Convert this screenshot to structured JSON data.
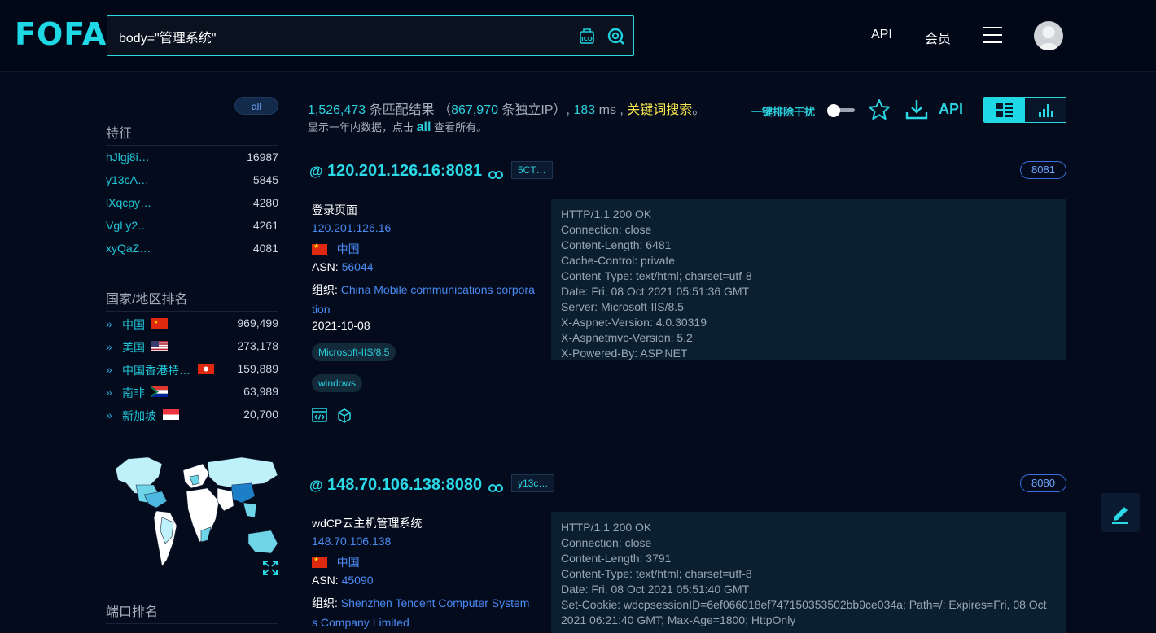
{
  "app": {
    "logo": "FOFA"
  },
  "search": {
    "query": "body=\"管理系统\""
  },
  "nav": {
    "api": "API",
    "member": "会员"
  },
  "sidebar": {
    "all_pill": "all",
    "features_title": "特征",
    "features": [
      {
        "label": "hJlgj8i…",
        "count": "16987"
      },
      {
        "label": "y13cA…",
        "count": "5845"
      },
      {
        "label": "lXqcpy…",
        "count": "4280"
      },
      {
        "label": "VgLy2…",
        "count": "4261"
      },
      {
        "label": "xyQaZ…",
        "count": "4081"
      }
    ],
    "country_title": "国家/地区排名",
    "countries": [
      {
        "name": "中国",
        "count": "969,499"
      },
      {
        "name": "美国",
        "count": "273,178"
      },
      {
        "name": "中国香港特…",
        "count": "159,889"
      },
      {
        "name": "南非",
        "count": "63,989"
      },
      {
        "name": "新加坡",
        "count": "20,700"
      }
    ],
    "port_title": "端口排名"
  },
  "summary": {
    "total": "1,526,473",
    "total_suffix": "条匹配结果",
    "paren_open": "（",
    "unique_ip": "867,970",
    "unique_suffix": "条独立IP）,",
    "ms": "183",
    "ms_suffix": "ms ,",
    "keyword": "关键词搜索",
    "period": "。",
    "line2_a": "显示一年内数据，点击",
    "line2_all": "all",
    "line2_b": "查看所有。"
  },
  "toolbar": {
    "exclude_label": "一键排除干扰",
    "api": "API"
  },
  "results": [
    {
      "host": "120.201.126.16:8081",
      "tag": "5CT…",
      "port": "8081",
      "title": "登录页面",
      "ip": "120.201.126.16",
      "country": "中国",
      "asn_label": "ASN:",
      "asn": "56044",
      "org_label": "组织:",
      "org": "China Mobile communications corporation",
      "date": "2021-10-08",
      "pills": [
        "Microsoft-IIS/8.5",
        "windows"
      ],
      "headers": [
        "HTTP/1.1 200 OK",
        "Connection: close",
        "Content-Length: 6481",
        "Cache-Control: private",
        "Content-Type: text/html; charset=utf-8",
        "Date: Fri, 08 Oct 2021 05:51:36 GMT",
        "Server: Microsoft-IIS/8.5",
        "X-Aspnet-Version: 4.0.30319",
        "X-Aspnetmvc-Version: 5.2",
        "X-Powered-By: ASP.NET"
      ]
    },
    {
      "host": "148.70.106.138:8080",
      "tag": "y13c…",
      "port": "8080",
      "title": "wdCP云主机管理系统",
      "ip": "148.70.106.138",
      "country": "中国",
      "asn_label": "ASN:",
      "asn": "45090",
      "org_label": "组织:",
      "org": "Shenzhen Tencent Computer Systems Company Limited",
      "headers": [
        "HTTP/1.1 200 OK",
        "Connection: close",
        "Content-Length: 3791",
        "Content-Type: text/html; charset=utf-8",
        "Date: Fri, 08 Oct 2021 05:51:40 GMT",
        "Set-Cookie: wdcpsessionID=6ef066018ef747150353502bb9ce034a; Path=/; Expires=Fri, 08 Oct 2021 06:21:40 GMT; Max-Age=1800; HttpOnly"
      ]
    }
  ],
  "colors": {
    "accent": "#2bd8e6",
    "link": "#4a8bf2",
    "keyword": "#f7e44a",
    "bg": "#030b1d"
  }
}
